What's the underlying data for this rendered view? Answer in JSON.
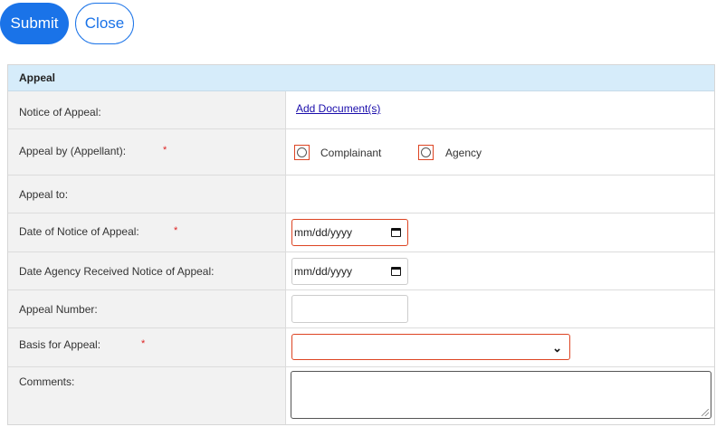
{
  "toolbar": {
    "submit_label": "Submit",
    "close_label": "Close"
  },
  "section": {
    "title": "Appeal",
    "rows": {
      "notice": {
        "label": "Notice of Appeal:",
        "link": "Add Document(s)"
      },
      "appeal_by": {
        "label": "Appeal by (Appellant):",
        "required": "*",
        "options": [
          "Complainant",
          "Agency"
        ],
        "selected": null
      },
      "appeal_to": {
        "label": "Appeal to:"
      },
      "date_notice": {
        "label": "Date of Notice of Appeal:",
        "required": "*",
        "value": "mm/dd/yyyy"
      },
      "date_received": {
        "label": "Date Agency Received Notice of Appeal:",
        "value": "mm/dd/yyyy"
      },
      "appeal_number": {
        "label": "Appeal Number:",
        "value": ""
      },
      "basis": {
        "label": "Basis for Appeal:",
        "required": "*",
        "value": ""
      },
      "comments": {
        "label": "Comments:",
        "value": ""
      }
    }
  },
  "colors": {
    "accent": "#1a73e8",
    "header_bg": "#d6ecfa",
    "required": "#dd2222",
    "invalid_border": "#dd4422"
  },
  "icons": {
    "calendar": "calendar-icon",
    "chevron": "chevron-down-icon"
  }
}
